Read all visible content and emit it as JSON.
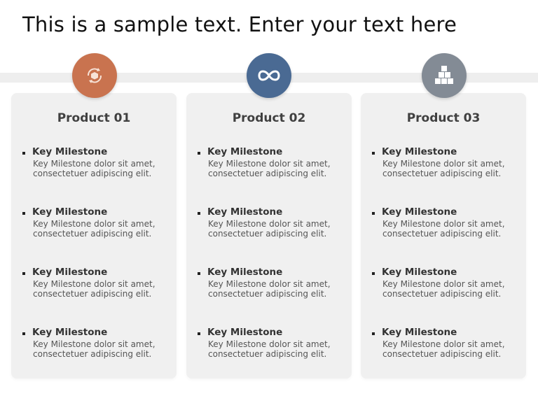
{
  "title": "This is a sample text. Enter your text here",
  "colors": {
    "product1": "#c9734f",
    "product2": "#4a6a93",
    "product3": "#838b95",
    "panel": "#f0f0f0"
  },
  "products": [
    {
      "name": "Product 01",
      "icon": "recycle-box-icon",
      "items": [
        {
          "heading": "Key Milestone",
          "line1": "Key Milestone dolor sit amet,",
          "line2": "consectetuer adipiscing  elit."
        },
        {
          "heading": "Key Milestone",
          "line1": "Key Milestone dolor sit amet,",
          "line2": "consectetuer adipiscing  elit."
        },
        {
          "heading": "Key Milestone",
          "line1": "Key Milestone dolor sit amet,",
          "line2": "consectetuer adipiscing  elit."
        },
        {
          "heading": "Key Milestone",
          "line1": "Key Milestone dolor sit amet,",
          "line2": "consectetuer adipiscing  elit."
        }
      ]
    },
    {
      "name": "Product 02",
      "icon": "infinity-icon",
      "items": [
        {
          "heading": "Key Milestone",
          "line1": "Key Milestone dolor sit amet,",
          "line2": "consectetuer adipiscing  elit."
        },
        {
          "heading": "Key Milestone",
          "line1": "Key Milestone dolor sit amet,",
          "line2": "consectetuer adipiscing  elit."
        },
        {
          "heading": "Key Milestone",
          "line1": "Key Milestone dolor sit amet,",
          "line2": "consectetuer adipiscing  elit."
        },
        {
          "heading": "Key Milestone",
          "line1": "Key Milestone dolor sit amet,",
          "line2": "consectetuer adipiscing  elit."
        }
      ]
    },
    {
      "name": "Product 03",
      "icon": "stacked-boxes-icon",
      "items": [
        {
          "heading": "Key Milestone",
          "line1": "Key Milestone dolor sit amet,",
          "line2": "consectetuer adipiscing  elit."
        },
        {
          "heading": "Key Milestone",
          "line1": "Key Milestone dolor sit amet,",
          "line2": "consectetuer adipiscing  elit."
        },
        {
          "heading": "Key Milestone",
          "line1": "Key Milestone dolor sit amet,",
          "line2": "consectetuer adipiscing  elit."
        },
        {
          "heading": "Key Milestone",
          "line1": "Key Milestone dolor sit amet,",
          "line2": "consectetuer adipiscing  elit."
        }
      ]
    }
  ]
}
